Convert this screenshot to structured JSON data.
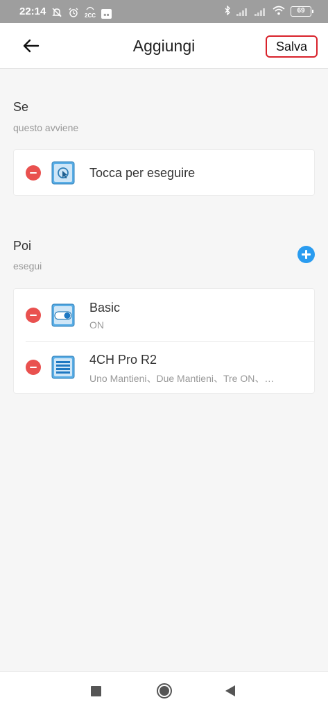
{
  "status_bar": {
    "time": "22:14",
    "network_label": "2CC",
    "battery": "69"
  },
  "header": {
    "title": "Aggiungi",
    "save_label": "Salva"
  },
  "trigger_section": {
    "title": "Se",
    "subtitle": "questo avviene",
    "items": [
      {
        "title": "Tocca per eseguire",
        "icon": "tap-to-run-icon"
      }
    ]
  },
  "action_section": {
    "title": "Poi",
    "subtitle": "esegui",
    "items": [
      {
        "title": "Basic",
        "subtitle": "ON",
        "icon": "switch-device-icon"
      },
      {
        "title": "4CH Pro R2",
        "subtitle": "Uno Mantieni、Due Mantieni、Tre ON、…",
        "icon": "multi-channel-device-icon"
      }
    ]
  },
  "colors": {
    "accent_blue": "#2a9cf0",
    "remove_red": "#e9514f",
    "save_outline": "#d8222b",
    "device_icon_blue": "#4aa3df"
  }
}
